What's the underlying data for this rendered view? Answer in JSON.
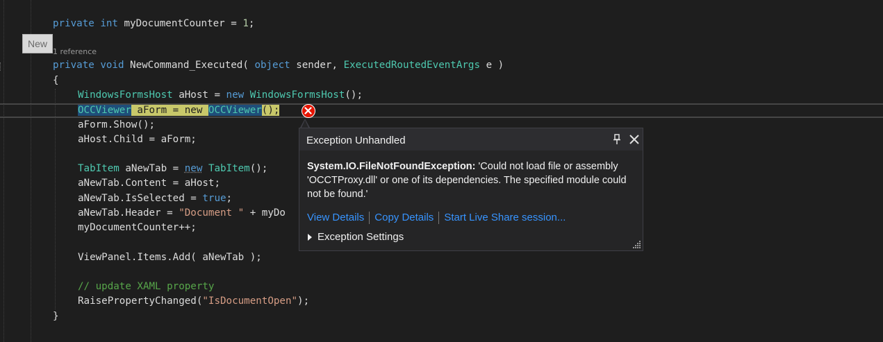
{
  "editor": {
    "code_lens": "1 reference",
    "new_tooltip": "New",
    "lines": {
      "l0_kw": "private",
      "l0_ty": "int",
      "l0_rest": " myDocumentCounter = ",
      "l0_num": "1",
      "l0_end": ";",
      "l1_kw1": "private",
      "l1_kw2": "void",
      "l1_name": " NewCommand_Executed( ",
      "l1_kw3": "object",
      "l1_mid": " sender, ",
      "l1_ty": "ExecutedRoutedEventArgs",
      "l1_end": " e )",
      "l2": "{",
      "l3_ty1": "WindowsFormsHost",
      "l3_mid": " aHost = ",
      "l3_kw": "new",
      "l3_sp": " ",
      "l3_ty2": "WindowsFormsHost",
      "l3_end": "();",
      "l4_ty1": "OCCViewer",
      "l4_mid": " aForm = new ",
      "l4_ty2": "OCCViewer",
      "l4_end": "();",
      "l5": "aForm.Show();",
      "l6": "aHost.Child = aForm;",
      "l7_ty1": "TabItem",
      "l7_mid": " aNewTab = ",
      "l7_kw": "new",
      "l7_sp": " ",
      "l7_ty2": "TabItem",
      "l7_end": "();",
      "l8": "aNewTab.Content = aHost;",
      "l9_start": "aNewTab.IsSelected = ",
      "l9_kw": "true",
      "l9_end": ";",
      "l10_start": "aNewTab.Header = ",
      "l10_str": "\"Document \"",
      "l10_end": " + myDo",
      "l11": "myDocumentCounter++;",
      "l12": "ViewPanel.Items.Add( aNewTab );",
      "l13": "// update XAML property",
      "l14_start": "RaisePropertyChanged(",
      "l14_str": "\"IsDocumentOpen\"",
      "l14_end": ");",
      "l15": "}"
    }
  },
  "exception_popup": {
    "title": "Exception Unhandled",
    "exception_type": "System.IO.FileNotFoundException:",
    "message": " 'Could not load file or assembly 'OCCTProxy.dll' or one of its dependencies. The specified module could not be found.'",
    "links": {
      "view_details": "View Details",
      "copy_details": "Copy Details",
      "live_share": "Start Live Share session..."
    },
    "settings_label": "Exception Settings"
  },
  "colors": {
    "background": "#1e1e1e",
    "keyword": "#569cd6",
    "type": "#4ec9b0",
    "string": "#d69d85",
    "comment": "#57a64a",
    "link": "#3794ff",
    "error": "#e51400"
  }
}
